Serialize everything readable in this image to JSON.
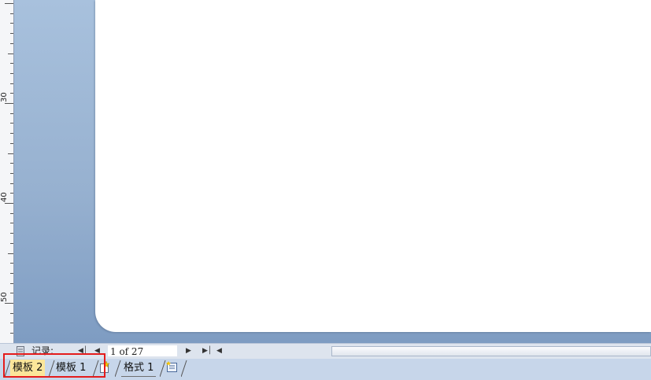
{
  "ruler": {
    "labels": [
      "30",
      "40",
      "50"
    ]
  },
  "navigation": {
    "records_label": "记录:",
    "record_position": "1 of 27"
  },
  "sheet_tabs": [
    {
      "label": "模板 2",
      "active": true
    },
    {
      "label": "模板 1",
      "active": false
    },
    {
      "label": "格式 1",
      "active": false
    }
  ],
  "icons": {
    "record_selector": "record-selector-icon",
    "first_record": "first-record-icon",
    "previous_record": "previous-record-icon",
    "next_record": "next-record-icon",
    "last_record": "last-record-icon",
    "scroll_left": "scroll-left-icon",
    "new_sheet": "new-sheet-icon",
    "new_format": "new-format-icon"
  },
  "colors": {
    "active_tab": "#fbe69a",
    "highlight_box": "#e41c1c",
    "workspace": "#97b1d0"
  }
}
